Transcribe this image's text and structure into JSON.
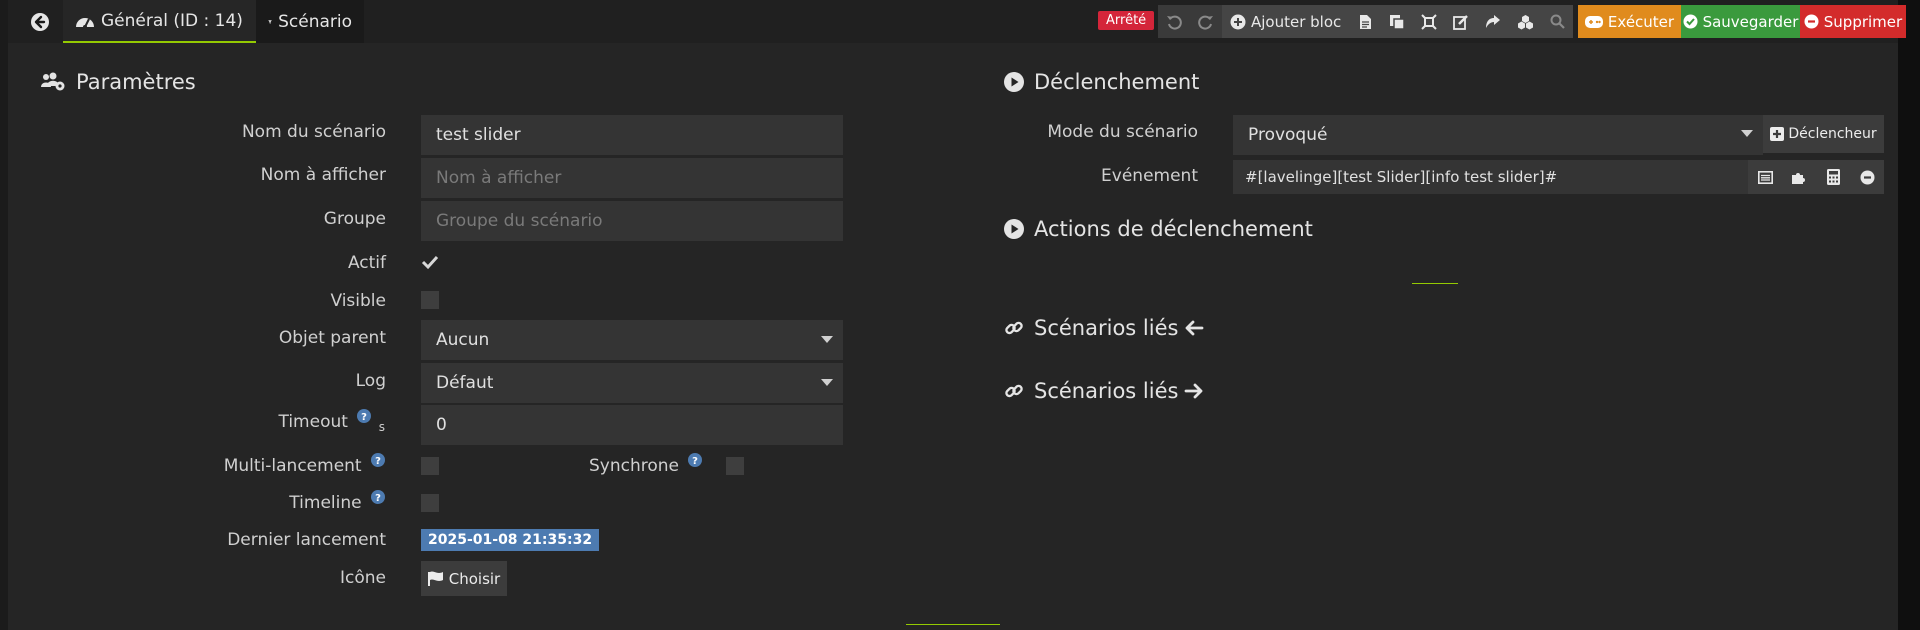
{
  "tabs": {
    "general": "Général (ID : 14)",
    "scenario": "Scénario"
  },
  "toolbar": {
    "status": "Arrêté",
    "add_block": "Ajouter bloc",
    "execute": "Exécuter",
    "save": "Sauvegarder",
    "delete": "Supprimer"
  },
  "params": {
    "title": "Paramètres",
    "name_label": "Nom du scénario",
    "name_value": "test slider",
    "display_label": "Nom à afficher",
    "display_placeholder": "Nom à afficher",
    "group_label": "Groupe",
    "group_placeholder": "Groupe du scénario",
    "active_label": "Actif",
    "active_checked": true,
    "visible_label": "Visible",
    "visible_checked": false,
    "parent_label": "Objet parent",
    "parent_value": "Aucun",
    "log_label": "Log",
    "log_value": "Défaut",
    "timeout_label": "Timeout",
    "timeout_unit": "s",
    "timeout_value": "0",
    "multi_label": "Multi-lancement",
    "multi_checked": false,
    "sync_label": "Synchrone",
    "sync_checked": false,
    "timeline_label": "Timeline",
    "timeline_checked": false,
    "last_run_label": "Dernier lancement",
    "last_run_value": "2025-01-08 21:35:32",
    "icon_label": "Icône",
    "icon_button": "Choisir"
  },
  "trigger": {
    "title": "Déclenchement",
    "mode_label": "Mode du scénario",
    "mode_value": "Provoqué",
    "trigger_button": "Déclencheur",
    "event_label": "Evénement",
    "event_value": "#[lavelinge][test Slider][info test slider]#"
  },
  "trigger_actions": {
    "title": "Actions de déclenchement"
  },
  "linked": {
    "title_in": "Scénarios liés",
    "title_out": "Scénarios liés"
  },
  "colors": {
    "accent": "#94ca02",
    "status": "#d4253a",
    "execute": "#e08b1d",
    "save": "#3a9a3d",
    "delete": "#d32b2b",
    "date_badge": "#4d7bb1"
  }
}
